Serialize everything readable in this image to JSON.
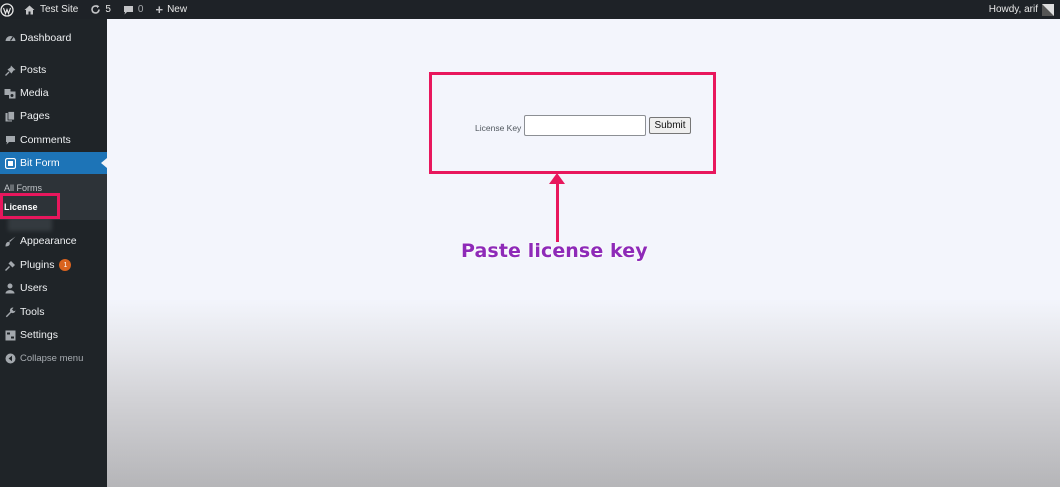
{
  "adminbar": {
    "site_title": "Test Site",
    "updates_count": "5",
    "comments_count": "0",
    "new_label": "New",
    "greeting": "Howdy, arif"
  },
  "sidebar": {
    "items": [
      {
        "label": "Dashboard",
        "icon": "dashboard-icon"
      },
      {
        "label": "Posts",
        "icon": "pin-icon"
      },
      {
        "label": "Media",
        "icon": "media-icon"
      },
      {
        "label": "Pages",
        "icon": "pages-icon"
      },
      {
        "label": "Comments",
        "icon": "comment-icon"
      },
      {
        "label": "Bit Form",
        "icon": "bitform-icon"
      },
      {
        "label": "Appearance",
        "icon": "brush-icon"
      },
      {
        "label": "Plugins",
        "icon": "plug-icon",
        "badge": "1"
      },
      {
        "label": "Users",
        "icon": "user-icon"
      },
      {
        "label": "Tools",
        "icon": "wrench-icon"
      },
      {
        "label": "Settings",
        "icon": "settings-icon"
      }
    ],
    "submenu": [
      {
        "label": "All Forms"
      },
      {
        "label": "License"
      }
    ],
    "collapse_label": "Collapse menu",
    "accent_color": "#1d74b7",
    "badge_color": "#d9631f"
  },
  "license_form": {
    "label": "License Key",
    "input_value": "",
    "submit_label": "Submit"
  },
  "annotation": {
    "text": "Paste license key",
    "highlight_color": "#e8175d",
    "text_color": "#8e2ab8"
  }
}
